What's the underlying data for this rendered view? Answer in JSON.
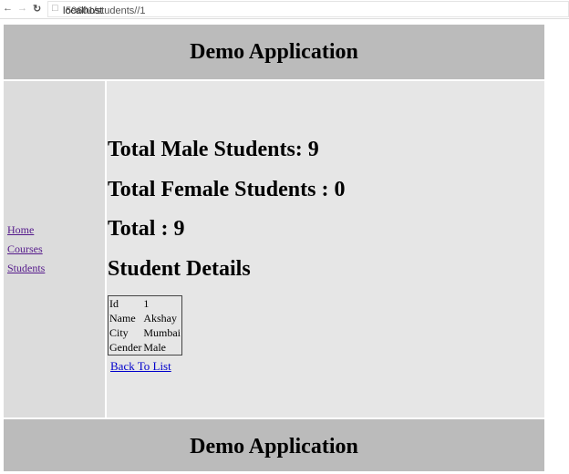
{
  "browser": {
    "url_host": "localhost",
    "url_path": ":59601/students//1"
  },
  "header": {
    "title": "Demo Application"
  },
  "sidebar": {
    "items": [
      {
        "label": "Home"
      },
      {
        "label": "Courses"
      },
      {
        "label": "Students"
      }
    ]
  },
  "main": {
    "male": "Total Male Students: 9",
    "female": "Total Female Students : 0",
    "total": "Total : 9",
    "details_title": "Student Details",
    "rows": [
      {
        "k": "Id",
        "v": "1"
      },
      {
        "k": "Name",
        "v": "Akshay"
      },
      {
        "k": "City",
        "v": "Mumbai"
      },
      {
        "k": "Gender",
        "v": "Male"
      }
    ],
    "back": "Back To List"
  },
  "footer": {
    "title": "Demo Application"
  }
}
